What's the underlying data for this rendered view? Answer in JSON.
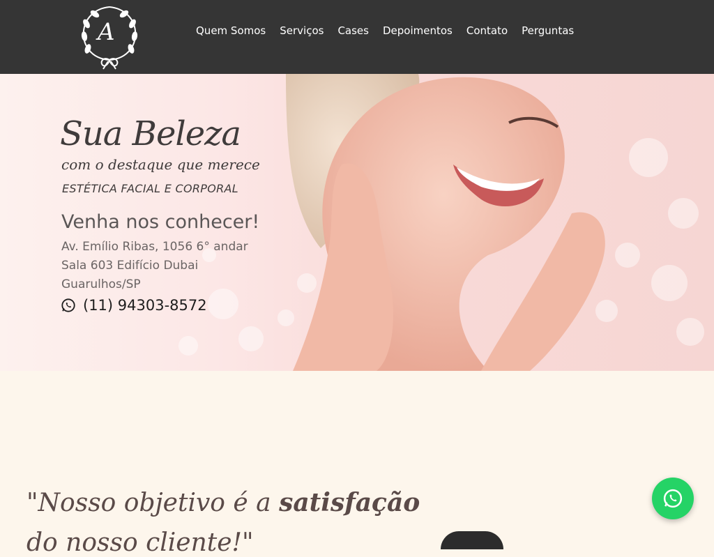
{
  "header": {
    "logo_letter": "A",
    "nav": [
      "Quem Somos",
      "Serviços",
      "Cases",
      "Depoimentos",
      "Contato",
      "Perguntas"
    ]
  },
  "hero": {
    "title": "Sua Beleza",
    "subtitle": "com o destaque que merece",
    "tagline": "ESTÉTICA FACIAL E CORPORAL",
    "cta": "Venha nos conhecer!",
    "address": [
      "Av. Emílio Ribas, 1056 6° andar",
      "Sala 603 Edifício Dubai",
      "Guarulhos/SP"
    ],
    "phone": "(11) 94303-8572",
    "phone_icon": "whatsapp-icon"
  },
  "section": {
    "quote_prefix": "\"Nosso objetivo é a ",
    "quote_bold": "satisfação",
    "quote_line2": "do nosso cliente!\""
  },
  "floating": {
    "icon": "whatsapp-icon"
  },
  "colors": {
    "header_bg": "#353535",
    "page_bg": "#fdf6ec",
    "whatsapp_green": "#25d366",
    "text_dark": "#3f3b3b"
  }
}
